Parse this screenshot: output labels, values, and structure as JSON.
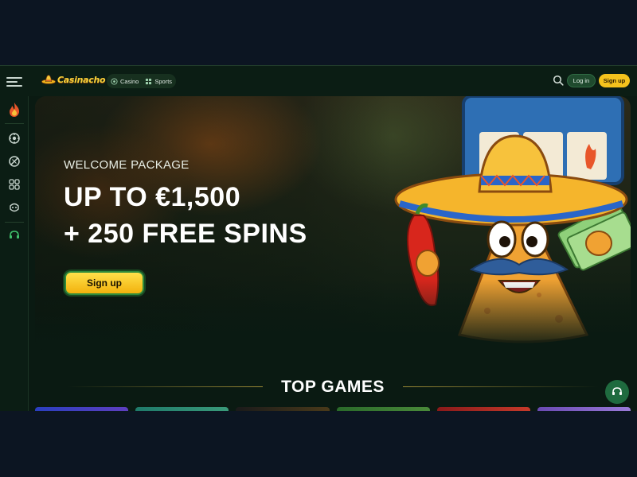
{
  "header": {
    "logo_text": "Casinacho",
    "nav": [
      {
        "label": "Casino",
        "icon": "casino-chip-icon"
      },
      {
        "label": "Sports",
        "icon": "sports-icon"
      }
    ],
    "login_label": "Log in",
    "signup_label": "Sign up"
  },
  "sidebar": {
    "icons": [
      "flame-icon",
      "casino-chip-icon",
      "sports-ball-icon",
      "live-casino-icon",
      "games-icon",
      "support-icon"
    ]
  },
  "hero": {
    "kicker": "WELCOME PACKAGE",
    "headline_line1": "UP TO €1,500",
    "headline_line2": "+ 250 FREE SPINS",
    "cta_label": "Sign up"
  },
  "top_games": {
    "title": "TOP GAMES"
  },
  "colors": {
    "brand_yellow": "#f4c21d",
    "brand_green": "#1f6b3f",
    "background": "#0a1a12"
  }
}
